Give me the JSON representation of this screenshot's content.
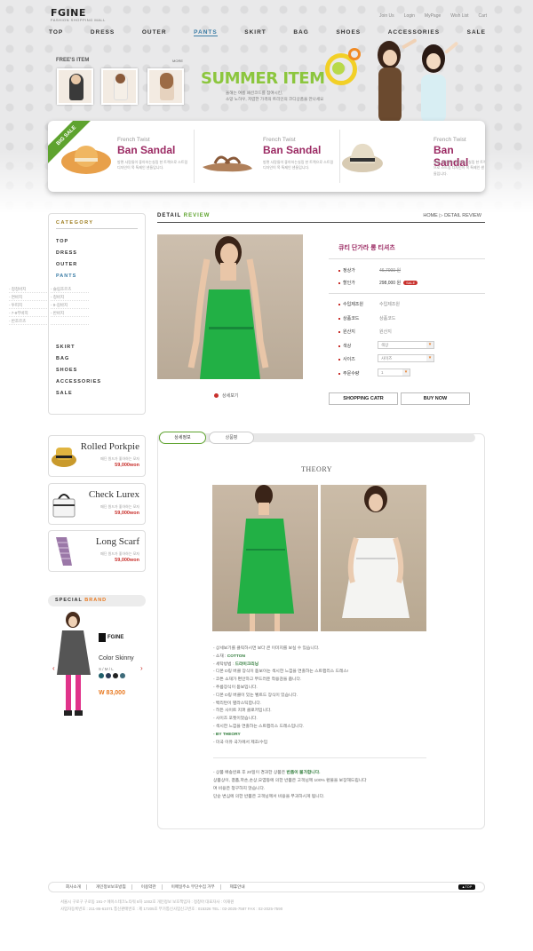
{
  "header": {
    "logo": "FGINE",
    "logo_sub": "FASHION SHOPPING MALL",
    "util_links": [
      "Join Us",
      "Login",
      "MyPage",
      "Wish List",
      "Cart"
    ],
    "nav": [
      "TOP",
      "DRESS",
      "OUTER",
      "PANTS",
      "SKIRT",
      "BAG",
      "SHOES",
      "ACCESSORIES",
      "SALE"
    ],
    "active_nav": "PANTS"
  },
  "banner": {
    "free_title": "FREE'S ITEM",
    "free_more": "MORE",
    "summer_title": "SUMMER ITEM",
    "summer_desc_1": "올해는 여름 패션코드를 참여시킨,",
    "summer_desc_2": "소망 노하우, 저렴한 가격의 트리인의 코디상품을 만나세요"
  },
  "sale": {
    "ribbon": "BIG SALE",
    "items": [
      {
        "brand": "French Twist",
        "name": "Ban Sandal",
        "desc": "방편 사랑들이 좋아하는실링 한 트렉으로 스트링 디자인이 목 특제인 샌들입니다."
      },
      {
        "brand": "French Twist",
        "name": "Ban Sandal",
        "desc": "방편 사랑들이 좋아하는실링 한 트렉으로 스트링 디자인이 목 특제인 샌들입니다."
      },
      {
        "brand": "French Twist",
        "name": "Ban Sandal",
        "desc": "방편 사랑들이 좋아하는실링 한 트렉으로 스트링 디자인이 목 특제인 샌들입니다."
      }
    ]
  },
  "category": {
    "title": "CATEGORY",
    "items_top": [
      "TOP",
      "DRESS",
      "OUTER",
      "PANTS"
    ],
    "active": "PANTS",
    "sub": [
      "- 청청바지",
      "- 슬림조르츠",
      "- 면바지",
      "- 청바지",
      "- 투피지",
      "- 9-길바지",
      "- 7-9부바지",
      "- 반바지",
      "- 반조르츠",
      ""
    ],
    "items_bottom": [
      "SKIRT",
      "BAG",
      "SHOES",
      "ACCESSORIES",
      "SALE"
    ]
  },
  "side_products": [
    {
      "name": "Rolled Porkpie",
      "desc": "패딘 원드가 좋아하는 모자",
      "price": "59,000won"
    },
    {
      "name": "Check Lurex",
      "desc": "패딘 원드가 좋아하는 모자",
      "price": "59,000won"
    },
    {
      "name": "Long Scarf",
      "desc": "패딘 원드가 좋아하는 모자",
      "price": "59,000won"
    }
  ],
  "special_brand": {
    "title_a": "SPECIAL",
    "title_b": "BRAND",
    "logo": "FGINE",
    "product": "Color Skinny",
    "size": "S / M / L",
    "price": "W 83,000",
    "prev": "‹",
    "next": "›",
    "swatches": [
      "#1f5f6b",
      "#2b3a55",
      "#222222",
      "#3e6b7a"
    ]
  },
  "detail": {
    "title_a": "DETAIL",
    "title_b": "REVIEW",
    "breadcrumb": "HOME ▷ DETAIL REVIEW",
    "view_label": "상세보기",
    "product_name": "큐티 단가라 롱 티셔츠",
    "rows": {
      "list_price_k": "정상가",
      "list_price_v": "46,7000 원",
      "sale_price_k": "할인가",
      "sale_price_v": "298,000 원",
      "sale_badge": "SALE",
      "maker_k": "수입제조원",
      "maker_v": "수입제조원",
      "code_k": "상품코드",
      "code_v": "상품코드",
      "origin_k": "원산지",
      "origin_v": "원산지",
      "color_k": "색상",
      "color_v": "색상",
      "size_k": "사이즈",
      "size_v": "사이즈",
      "qty_k": "주문수량",
      "qty_v": "1"
    },
    "buttons": {
      "cart": "SHOPPING CATR",
      "buy": "BUY NOW"
    }
  },
  "info": {
    "tab_detail": "상세정보",
    "tab_review": "상품평",
    "brand_title": "THEORY",
    "desc": [
      "- 상세보기를 클릭하시면 보다 큰 이미지를 보실 수 있습니다.",
      "- 소재 : ",
      "- 세탁방법 : ",
      "- 디몬 D링 버클 장식이 돋보이는 섹시한 느낌을 연출하는 스트랩리스 드레스!",
      "- 코튼 소재가 편안하고 부드러운 착용감을 줍니다.",
      "- 주름장식이 돋보입니다.",
      "- 디몬 D링 버클이 있는 벨트드 장식이 있습니다.",
      "- 백리턴이 별라스틱합니다.",
      "- 히든 사이트 지퍼 클로저입니다.",
      "- 사이즈 포켓이었습니다.",
      "- 섹시한 느낌을 연출하는 스트랩리스 드레스입니다.",
      "- BY THEORY",
      "- 미국 이유 국가에서 제조/수입"
    ],
    "desc_fabric": "COTTON",
    "desc_wash": "드라이크리닝",
    "notice": [
      "- 상품 배송완료 후 20일이 경과한 상품은 ",
      "  상품상이, 결품,파손,손상,오염등에 의한 반품은 고객님께 100% 환불을 보장해드립니다",
      "  며 비용은 청구하지 않습니다.",
      "  단순 변심에 의한 반품은 고객님께서 비용을 부과하시게 됩니다."
    ],
    "notice_hl": "반품이 불가합니다."
  },
  "footer": {
    "nav": [
      "회사소개",
      "개인정보보호방침",
      "이용약관",
      "이메일주소 무단수집 거부",
      "제휴안내"
    ],
    "top": "▲TOP",
    "addr_1": "서울시 구로구 구로동 191-7 에이스테크노타워 8차 1002호    개인정보 보호책임자 : 정창아    대표자사 : 이재원",
    "addr_2": "사업자등록번호 : 211-86-61071    통신판매번호 : 제 17205호    부가통신사업신고번호 : 015326    TEL : 02-2025-7587    FAX : 02-2025-7590"
  }
}
